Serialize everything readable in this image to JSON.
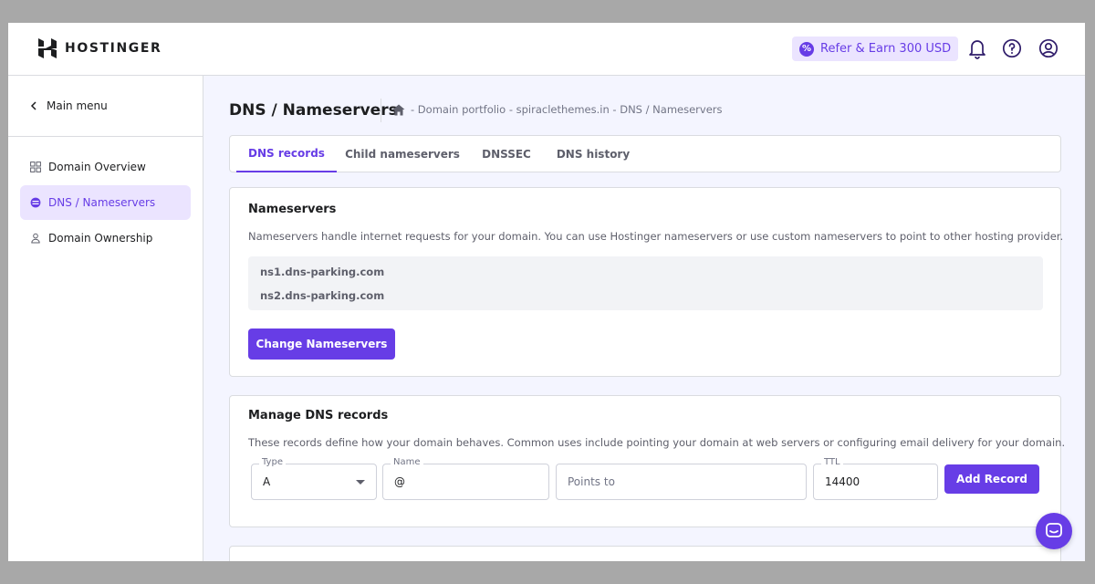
{
  "header": {
    "brand": "HOSTINGER",
    "refer_label": "Refer & Earn 300 USD",
    "refer_icon": "percent-badge-icon",
    "icons": [
      "bell-icon",
      "help-icon",
      "account-icon"
    ]
  },
  "sidebar": {
    "main_menu": "Main menu",
    "items": [
      {
        "label": "Domain Overview",
        "icon": "grid-icon",
        "active": false
      },
      {
        "label": "DNS / Nameservers",
        "icon": "dns-icon",
        "active": true
      },
      {
        "label": "Domain Ownership",
        "icon": "person-icon",
        "active": false
      }
    ]
  },
  "page": {
    "title": "DNS / Nameservers",
    "breadcrumb": "- Domain portfolio - spiraclethemes.in - DNS / Nameservers"
  },
  "tabs": [
    {
      "label": "DNS records",
      "active": true
    },
    {
      "label": "Child nameservers",
      "active": false
    },
    {
      "label": "DNSSEC",
      "active": false
    },
    {
      "label": "DNS history",
      "active": false
    }
  ],
  "nameservers": {
    "title": "Nameservers",
    "description": "Nameservers handle internet requests for your domain. You can use Hostinger nameservers or use custom nameservers to point to other hosting provider.",
    "ns1": "ns1.dns-parking.com",
    "ns2": "ns2.dns-parking.com",
    "button": "Change Nameservers"
  },
  "manage": {
    "title": "Manage DNS records",
    "description": "These records define how your domain behaves. Common uses include pointing your domain at web servers or configuring email delivery for your domain.",
    "type_label": "Type",
    "type_value": "A",
    "name_label": "Name",
    "name_value": "@",
    "points_placeholder": "Points to",
    "ttl_label": "TTL",
    "ttl_value": "14400",
    "button": "Add Record"
  },
  "colors": {
    "accent": "#673de6",
    "accent_light": "#ebe4ff",
    "text_dark": "#1d1e20",
    "text_muted": "#5e5f6b"
  }
}
